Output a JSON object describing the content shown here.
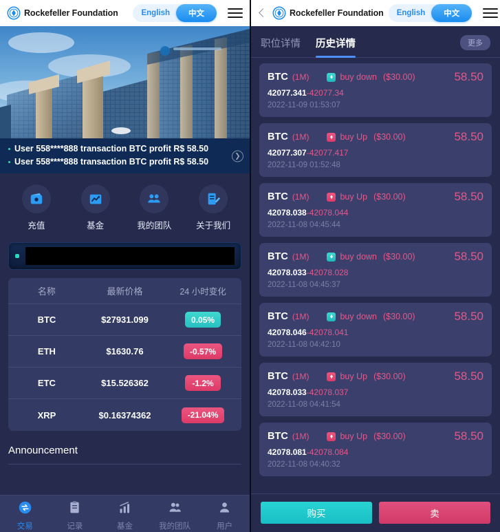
{
  "colors": {
    "accent_blue": "#2b8cf0",
    "teal": "#2BC7C7",
    "pink": "#E0426E",
    "panel_bg": "#262b4d",
    "card_bg": "#3a406b"
  },
  "left": {
    "header": {
      "brand": "Rockefeller Foundation",
      "lang_en": "English",
      "lang_zh": "中文",
      "logo_icon": "rockefeller-logo-icon",
      "menu_icon": "hamburger-menu-icon"
    },
    "hero": {
      "alt": "modern glass office towers against blue sky"
    },
    "ticker": {
      "lines": [
        "User 558****888 transaction BTC profit R$ 58.50",
        "User 558****888 transaction BTC profit R$ 58.50"
      ],
      "next_icon": "chevron-right-icon"
    },
    "quick_actions": [
      {
        "label": "充值",
        "icon": "wallet-icon"
      },
      {
        "label": "基金",
        "icon": "chart-growth-icon"
      },
      {
        "label": "我的团队",
        "icon": "team-icon"
      },
      {
        "label": "关于我们",
        "icon": "document-edit-icon"
      }
    ],
    "banner": {
      "dot_icon": "status-dot-icon"
    },
    "crypto_table": {
      "headers": [
        "名称",
        "最新价格",
        "24 小时变化"
      ],
      "rows": [
        {
          "name": "BTC",
          "price": "$27931.099",
          "change": "0.05%",
          "dir": "up"
        },
        {
          "name": "ETH",
          "price": "$1630.76",
          "change": "-0.57%",
          "dir": "down"
        },
        {
          "name": "ETC",
          "price": "$15.526362",
          "change": "-1.2%",
          "dir": "down"
        },
        {
          "name": "XRP",
          "price": "$0.16374362",
          "change": "-21.04%",
          "dir": "down"
        }
      ]
    },
    "announcement": {
      "title": "Announcement"
    },
    "bottom_nav": [
      {
        "label": "交易",
        "icon": "exchange-icon",
        "active": true
      },
      {
        "label": "记录",
        "icon": "records-icon",
        "active": false
      },
      {
        "label": "基金",
        "icon": "fund-chart-icon",
        "active": false
      },
      {
        "label": "我的团队",
        "icon": "team-icon",
        "active": false
      },
      {
        "label": "用户",
        "icon": "user-profile-icon",
        "active": false
      }
    ]
  },
  "right": {
    "header": {
      "back_icon": "back-chevron-icon",
      "brand": "Rockefeller Foundation",
      "lang_en": "English",
      "lang_zh": "中文",
      "logo_icon": "rockefeller-logo-icon",
      "menu_icon": "hamburger-menu-icon"
    },
    "tabs": [
      {
        "label": "职位详情",
        "active": false
      },
      {
        "label": "历史详情",
        "active": true
      }
    ],
    "more_label": "更多",
    "trades": [
      {
        "symbol": "BTC",
        "period": "(1M)",
        "direction": "buy down",
        "dir": "down",
        "amount": "($30.00)",
        "profit": "58.50",
        "open": "42077.341",
        "close": "42077.34",
        "time": "2022-11-09 01:53:07"
      },
      {
        "symbol": "BTC",
        "period": "(1M)",
        "direction": "buy Up",
        "dir": "up",
        "amount": "($30.00)",
        "profit": "58.50",
        "open": "42077.307",
        "close": "42077.417",
        "time": "2022-11-09 01:52:48"
      },
      {
        "symbol": "BTC",
        "period": "(1M)",
        "direction": "buy Up",
        "dir": "up",
        "amount": "($30.00)",
        "profit": "58.50",
        "open": "42078.038",
        "close": "42078.044",
        "time": "2022-11-08 04:45:44"
      },
      {
        "symbol": "BTC",
        "period": "(1M)",
        "direction": "buy down",
        "dir": "down",
        "amount": "($30.00)",
        "profit": "58.50",
        "open": "42078.033",
        "close": "42078.028",
        "time": "2022-11-08 04:45:37"
      },
      {
        "symbol": "BTC",
        "period": "(1M)",
        "direction": "buy down",
        "dir": "down",
        "amount": "($30.00)",
        "profit": "58.50",
        "open": "42078.046",
        "close": "42078.041",
        "time": "2022-11-08 04:42:10"
      },
      {
        "symbol": "BTC",
        "period": "(1M)",
        "direction": "buy Up",
        "dir": "up",
        "amount": "($30.00)",
        "profit": "58.50",
        "open": "42078.033",
        "close": "42078.037",
        "time": "2022-11-08 04:41:54"
      },
      {
        "symbol": "BTC",
        "period": "(1M)",
        "direction": "buy Up",
        "dir": "up",
        "amount": "($30.00)",
        "profit": "58.50",
        "open": "42078.081",
        "close": "42078.084",
        "time": "2022-11-08 04:40:32"
      }
    ],
    "actions": {
      "buy_label": "购买",
      "sell_label": "卖"
    }
  }
}
